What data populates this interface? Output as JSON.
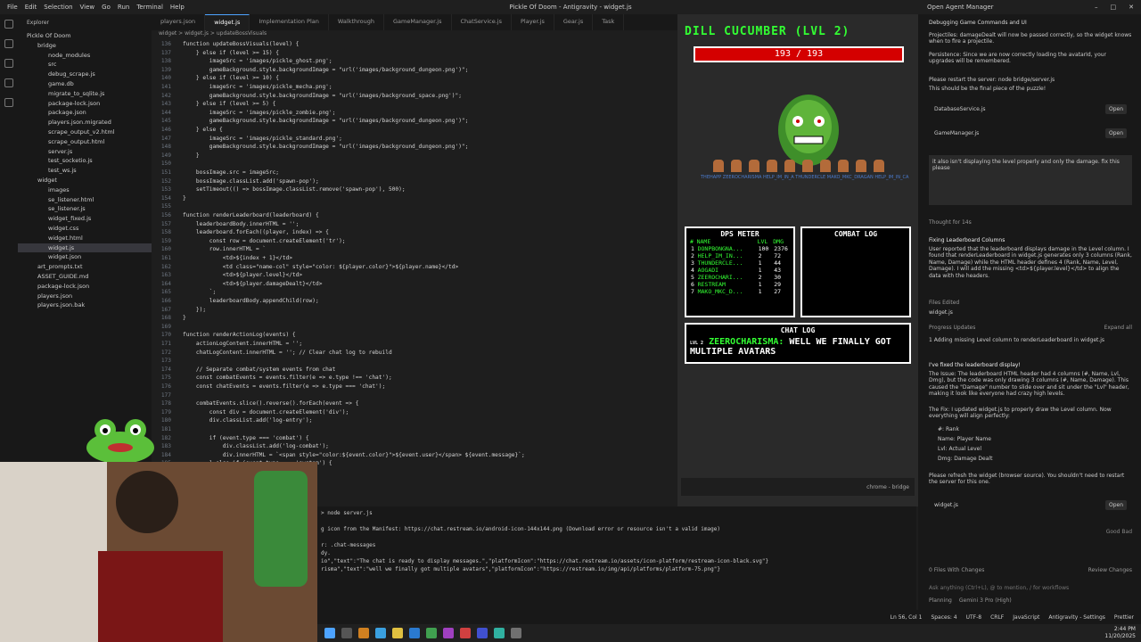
{
  "titlebar": {
    "menus": [
      "File",
      "Edit",
      "Selection",
      "View",
      "Go",
      "Run",
      "Terminal",
      "Help"
    ],
    "title": "Pickle Of Doom - Antigravity - widget.js",
    "agent_manager": "Open Agent Manager"
  },
  "explorer": {
    "header": "Explorer",
    "items": [
      {
        "label": "Pickle Of Doom",
        "depth": 0
      },
      {
        "label": "bridge",
        "depth": 1
      },
      {
        "label": "node_modules",
        "depth": 2
      },
      {
        "label": "src",
        "depth": 2
      },
      {
        "label": "debug_scrape.js",
        "depth": 2
      },
      {
        "label": "game.db",
        "depth": 2
      },
      {
        "label": "migrate_to_sqlite.js",
        "depth": 2
      },
      {
        "label": "package-lock.json",
        "depth": 2
      },
      {
        "label": "package.json",
        "depth": 2
      },
      {
        "label": "players.json.migrated",
        "depth": 2
      },
      {
        "label": "scrape_output_v2.html",
        "depth": 2
      },
      {
        "label": "scrape_output.html",
        "depth": 2
      },
      {
        "label": "server.js",
        "depth": 2
      },
      {
        "label": "test_socketio.js",
        "depth": 2
      },
      {
        "label": "test_ws.js",
        "depth": 2
      },
      {
        "label": "widget",
        "depth": 1
      },
      {
        "label": "images",
        "depth": 2
      },
      {
        "label": "se_listener.html",
        "depth": 2
      },
      {
        "label": "se_listener.js",
        "depth": 2
      },
      {
        "label": "widget_fixed.js",
        "depth": 2
      },
      {
        "label": "widget.css",
        "depth": 2
      },
      {
        "label": "widget.html",
        "depth": 2
      },
      {
        "label": "widget.js",
        "depth": 2,
        "selected": true
      },
      {
        "label": "widget.json",
        "depth": 2
      },
      {
        "label": "art_prompts.txt",
        "depth": 1
      },
      {
        "label": "ASSET_GUIDE.md",
        "depth": 1
      },
      {
        "label": "package-lock.json",
        "depth": 1
      },
      {
        "label": "players.json",
        "depth": 1
      },
      {
        "label": "players.json.bak",
        "depth": 1
      }
    ]
  },
  "tabs": [
    "players.json",
    "widget.js",
    "Implementation Plan",
    "Walkthrough",
    "GameManager.js",
    "ChatService.js",
    "Player.js",
    "Gear.js",
    "Task"
  ],
  "breadcrumb": "widget > widget.js > updateBossVisuals",
  "editor": {
    "lines": [
      {
        "n": "136",
        "t": "function updateBossVisuals(level) {"
      },
      {
        "n": "137",
        "t": "    } else if (level >= 15) {"
      },
      {
        "n": "138",
        "t": "        imageSrc = 'images/pickle_ghost.png';"
      },
      {
        "n": "139",
        "t": "        gameBackground.style.backgroundImage = \"url('images/background_dungeon.png')\";"
      },
      {
        "n": "140",
        "t": "    } else if (level >= 10) {"
      },
      {
        "n": "141",
        "t": "        imageSrc = 'images/pickle_mecha.png';"
      },
      {
        "n": "142",
        "t": "        gameBackground.style.backgroundImage = \"url('images/background_space.png')\";"
      },
      {
        "n": "143",
        "t": "    } else if (level >= 5) {"
      },
      {
        "n": "144",
        "t": "        imageSrc = 'images/pickle_zombie.png';"
      },
      {
        "n": "145",
        "t": "        gameBackground.style.backgroundImage = \"url('images/background_dungeon.png')\";"
      },
      {
        "n": "146",
        "t": "    } else {"
      },
      {
        "n": "147",
        "t": "        imageSrc = 'images/pickle_standard.png';"
      },
      {
        "n": "148",
        "t": "        gameBackground.style.backgroundImage = \"url('images/background_dungeon.png')\";"
      },
      {
        "n": "149",
        "t": "    }"
      },
      {
        "n": "150",
        "t": ""
      },
      {
        "n": "151",
        "t": "    bossImage.src = imageSrc;"
      },
      {
        "n": "152",
        "t": "    bossImage.classList.add('spawn-pop');"
      },
      {
        "n": "153",
        "t": "    setTimeout(() => bossImage.classList.remove('spawn-pop'), 500);"
      },
      {
        "n": "154",
        "t": "}"
      },
      {
        "n": "155",
        "t": ""
      },
      {
        "n": "156",
        "t": "function renderLeaderboard(leaderboard) {"
      },
      {
        "n": "157",
        "t": "    leaderboardBody.innerHTML = '';"
      },
      {
        "n": "158",
        "t": "    leaderboard.forEach((player, index) => {"
      },
      {
        "n": "159",
        "t": "        const row = document.createElement('tr');"
      },
      {
        "n": "160",
        "t": "        row.innerHTML = `"
      },
      {
        "n": "161",
        "t": "            <td>${index + 1}</td>"
      },
      {
        "n": "162",
        "t": "            <td class=\"name-col\" style=\"color: ${player.color}\">${player.name}</td>"
      },
      {
        "n": "163",
        "t": "            <td>${player.level}</td>"
      },
      {
        "n": "164",
        "t": "            <td>${player.damageDealt}</td>"
      },
      {
        "n": "165",
        "t": "        `;"
      },
      {
        "n": "166",
        "t": "        leaderboardBody.appendChild(row);"
      },
      {
        "n": "167",
        "t": "    });"
      },
      {
        "n": "168",
        "t": "}"
      },
      {
        "n": "169",
        "t": ""
      },
      {
        "n": "170",
        "t": "function renderActionLog(events) {"
      },
      {
        "n": "171",
        "t": "    actionLogContent.innerHTML = '';"
      },
      {
        "n": "172",
        "t": "    chatLogContent.innerHTML = ''; // Clear chat log to rebuild"
      },
      {
        "n": "173",
        "t": ""
      },
      {
        "n": "174",
        "t": "    // Separate combat/system events from chat"
      },
      {
        "n": "175",
        "t": "    const combatEvents = events.filter(e => e.type !== 'chat');"
      },
      {
        "n": "176",
        "t": "    const chatEvents = events.filter(e => e.type === 'chat');"
      },
      {
        "n": "177",
        "t": ""
      },
      {
        "n": "178",
        "t": "    combatEvents.slice().reverse().forEach(event => {"
      },
      {
        "n": "179",
        "t": "        const div = document.createElement('div');"
      },
      {
        "n": "180",
        "t": "        div.classList.add('log-entry');"
      },
      {
        "n": "181",
        "t": ""
      },
      {
        "n": "182",
        "t": "        if (event.type === 'combat') {"
      },
      {
        "n": "183",
        "t": "            div.classList.add('log-combat');"
      },
      {
        "n": "184",
        "t": "            div.innerHTML = `<span style=\"color:${event.color}\">${event.user}</span> ${event.message}`;"
      },
      {
        "n": "185",
        "t": "        } else if (event.type === 'system') {"
      }
    ]
  },
  "terminal": {
    "lines": [
      "> node server.js",
      "",
      "g icon from the Manifest: https://chat.restream.io/android-icon-144x144.png (Download error or resource isn't a valid image)",
      "",
      "r: .chat-messages",
      "dy.",
      "io\",\"text\":\"The chat is ready to display messages.\",\"platformIcon\":\"https://chat.restream.io/assets/icon-platform/restream-icon-black.svg\"}",
      "risma\",\"text\":\"well we finally got multiple avatars\",\"platformIcon\":\"https://restream.io/img/api/platforms/platform-75.png\"}"
    ]
  },
  "overlay": {
    "boss_name": "DILL CUCUMBER (LVL 2)",
    "hp_text": "193 / 193",
    "hp_fraction": 1.0,
    "hero_names": "THEHAPP ZEEROCHARISMA HELP_IM_IN_A THUNDERCLE MAKO_MKC_DRAGAN HELP_IM_IN_CA",
    "dps": {
      "title": "DPS METER",
      "headers": [
        "#",
        "NAME",
        "LVL",
        "DMG"
      ],
      "rows": [
        [
          "1",
          "DONPBONGNA...",
          "100",
          "2376"
        ],
        [
          "2",
          "HELP_IM_IN...",
          "2",
          "72"
        ],
        [
          "3",
          "THUNDERCLE...",
          "1",
          "44"
        ],
        [
          "4",
          "AOGADI",
          "1",
          "43"
        ],
        [
          "5",
          "ZEEROCHARI...",
          "2",
          "30"
        ],
        [
          "6",
          "RESTREAM",
          "1",
          "29"
        ],
        [
          "7",
          "MAKO_MKC_D...",
          "1",
          "27"
        ]
      ]
    },
    "combat_title": "COMBAT LOG",
    "chat_title": "CHAT LOG",
    "chat_lvl": "LVL 2",
    "chat_user": "ZEEROCHARISMA:",
    "chat_text": "WELL WE FINALLY GOT MULTIPLE AVATARS",
    "browser_label": "chrome - bridge"
  },
  "agent": {
    "title": "Debugging Game Commands and UI",
    "p1": "Projectiles: damageDealt will now be passed correctly, so the widget knows when to fire a projectile.",
    "p2": "Persistence: Since we are now correctly loading the avatarId, your upgrades will be remembered.",
    "p3": "Please restart the server: node bridge/server.js",
    "p4": "This should be the final piece of the puzzle!",
    "file1": "DatabaseService.js",
    "file2": "GameManager.js",
    "open": "Open",
    "user_msg": "it also isn't displaying the level properly and only the damage. fix this please",
    "thought": "Thought for 14s",
    "h1": "Fixing Leaderboard Columns",
    "p5": "User reported that the leaderboard displays damage in the Level column. I found that renderLeaderboard in widget.js generates only 3 columns (Rank, Name, Damage) while the HTML header defines 4 (Rank, Name, Level, Damage). I will add the missing <td>${player.level}</td> to align the data with the headers.",
    "files_edited": "Files Edited",
    "file3": "widget.js",
    "progress": "Progress Updates",
    "expand": "Expand all",
    "step": "1  Adding missing Level column to renderLeaderboard in widget.js",
    "p6": "I've fixed the leaderboard display!",
    "p7": "The Issue: The leaderboard HTML header had 4 columns (#, Name, Lvl, Dmg), but the code was only drawing 3 columns (#, Name, Damage). This caused the \"Damage\" number to slide over and sit under the \"Lvl\" header, making it look like everyone had crazy high levels.",
    "p8": "The Fix: I updated widget.js to properly draw the Level column. Now everything will align perfectly:",
    "b1": "#: Rank",
    "b2": "Name: Player Name",
    "b3": "Lvl: Actual Level",
    "b4": "Dmg: Damage Dealt",
    "p9": "Please refresh the widget (browser source). You shouldn't need to restart the server for this one.",
    "file4": "widget.js",
    "feedback": "Good  Bad",
    "changes": "0 Files With Changes",
    "review": "Review Changes",
    "input_placeholder": "Ask anything (Ctrl+L), @ to mention, / for workflows",
    "mode": "Planning",
    "model": "Gemini 3 Pro (High)"
  },
  "statusbar": [
    "Ln 56, Col 1",
    "Spaces: 4",
    "UTF-8",
    "CRLF",
    "JavaScript",
    "Antigravity - Settings",
    "Prettier"
  ],
  "clock": {
    "time": "2:44 PM",
    "date": "11/20/2025"
  },
  "colors": {
    "accent": "#33ff33",
    "hp": "#d40000",
    "editor_bg": "#1e1e1e",
    "side_bg": "#181818"
  }
}
